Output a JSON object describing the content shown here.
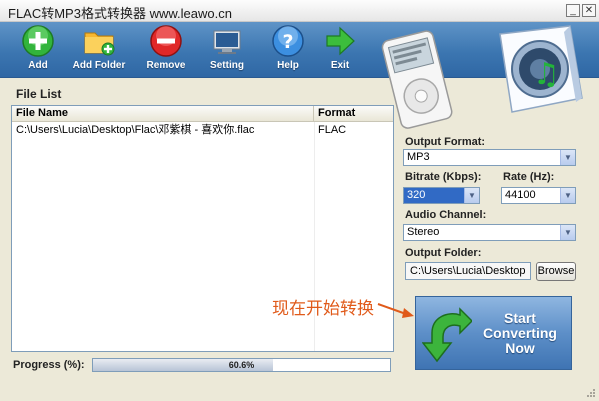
{
  "window": {
    "title": "FLAC转MP3格式转换器 www.leawo.cn",
    "minimize": "_",
    "close": "✕"
  },
  "toolbar": [
    {
      "label": "Add",
      "icon": "plus-icon"
    },
    {
      "label": "Add Folder",
      "icon": "folder-add-icon"
    },
    {
      "label": "Remove",
      "icon": "minus-icon"
    },
    {
      "label": "Setting",
      "icon": "monitor-icon"
    },
    {
      "label": "Help",
      "icon": "question-icon"
    },
    {
      "label": "Exit",
      "icon": "arrow-right-icon"
    }
  ],
  "file_list": {
    "title": "File List",
    "headers": [
      "File Name",
      "Format"
    ],
    "rows": [
      {
        "name": "C:\\Users\\Lucia\\Desktop\\Flac\\邓紫棋 - 喜欢你.flac",
        "format": "FLAC"
      }
    ]
  },
  "progress": {
    "label": "Progress (%):",
    "value": 60.6,
    "text": "60.6%"
  },
  "settings": {
    "output_format_label": "Output Format:",
    "output_format": "MP3",
    "bitrate_label": "Bitrate (Kbps):",
    "bitrate": "320",
    "rate_label": "Rate (Hz):",
    "rate": "44100",
    "channel_label": "Audio Channel:",
    "channel": "Stereo",
    "folder_label": "Output Folder:",
    "folder": "C:\\Users\\Lucia\\Desktop",
    "browse": "Browse"
  },
  "hint": "现在开始转换",
  "start_button": {
    "line1": "Start",
    "line2": "Converting",
    "line3": "Now"
  },
  "colors": {
    "toolbar": "#3c76b1",
    "hint": "#e05a1a",
    "selection": "#316ac5"
  }
}
